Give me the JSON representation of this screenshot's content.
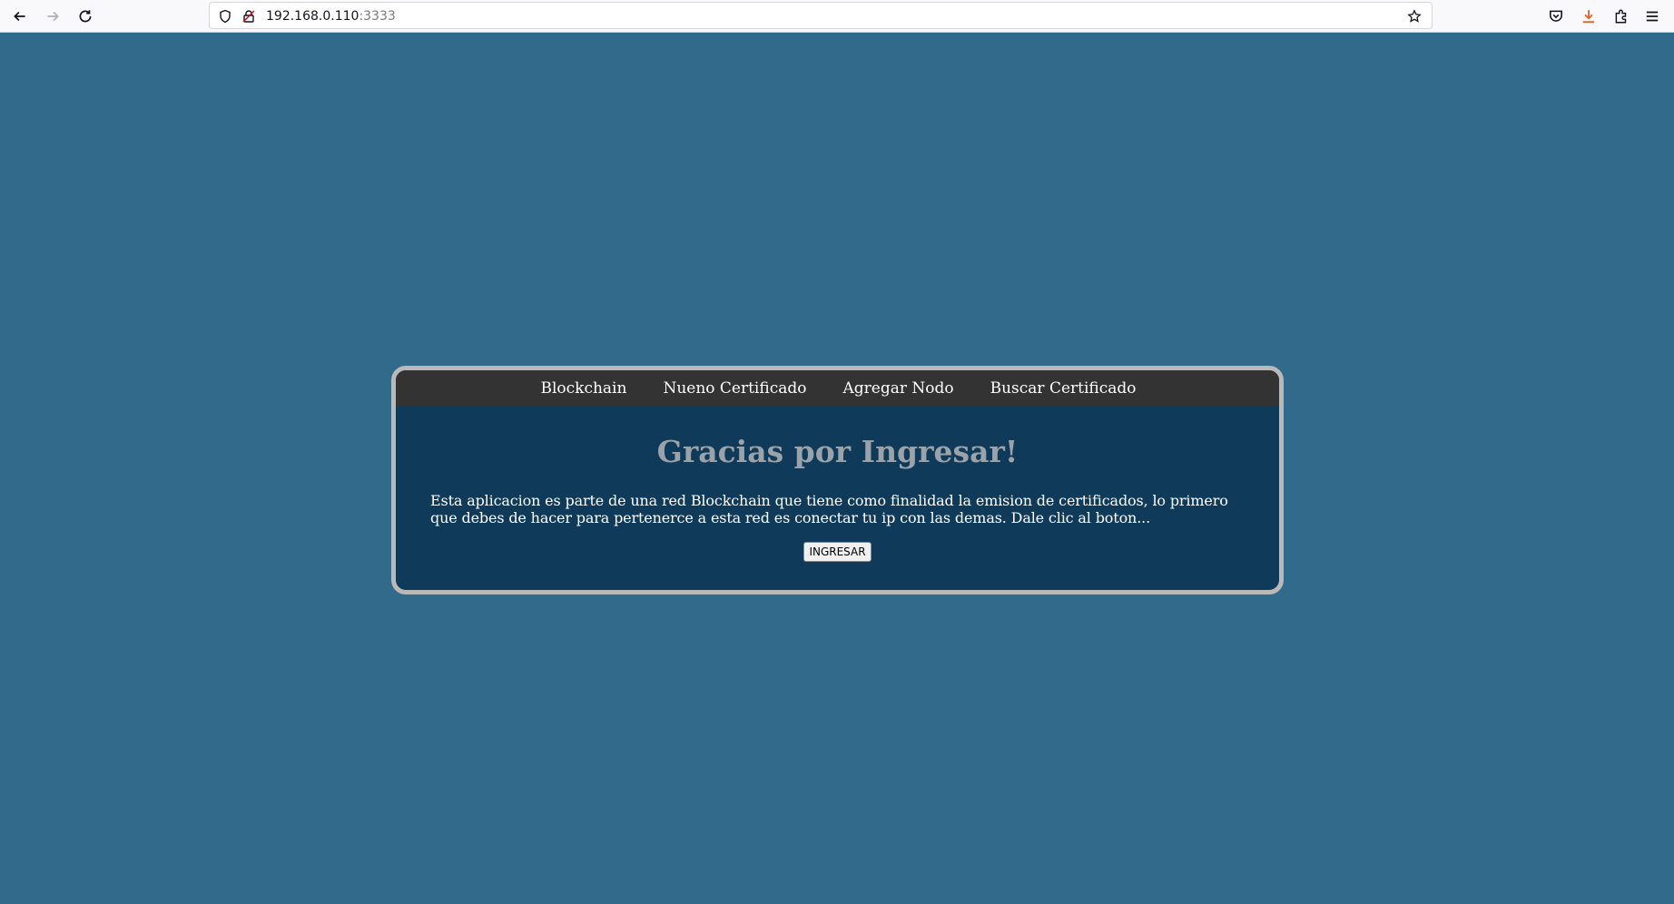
{
  "browser": {
    "url_host": "192.168.0.110",
    "url_port": ":3333",
    "icons": [
      "back-icon",
      "forward-icon",
      "reload-icon",
      "shield-icon",
      "insecure-lock-icon",
      "bookmark-star-icon",
      "pocket-icon",
      "downloads-icon",
      "extensions-icon",
      "menu-icon"
    ]
  },
  "nav": {
    "items": [
      "Blockchain",
      "Nueno Certificado",
      "Agregar Nodo",
      "Buscar Certificado"
    ]
  },
  "main": {
    "title": "Gracias por Ingresar!",
    "description": "Esta aplicacion es parte de una red Blockchain que tiene como finalidad la emision de certificados, lo primero que debes de hacer para pertenerce a esta red es conectar tu ip con las demas. Dale clic al boton...",
    "button_label": "INGRESAR"
  },
  "colors": {
    "page_background": "#326a8c",
    "card_background": "#0f3a5a",
    "nav_background": "#333333",
    "card_border": "#b9b9b9",
    "title_color": "#9aa3aa",
    "downloads_accent": "#e8602c"
  }
}
